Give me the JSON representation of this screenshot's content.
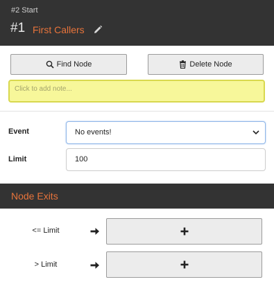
{
  "header": {
    "subtitle": "#2 Start",
    "number": "#1",
    "name": "First Callers",
    "edit_icon": "pencil-icon"
  },
  "toolbar": {
    "find_label": "Find Node",
    "find_icon": "search-icon",
    "delete_label": "Delete Node",
    "delete_icon": "trash-icon"
  },
  "note": {
    "placeholder": "Click to add note..."
  },
  "form": {
    "event_label": "Event",
    "event_value": "No events!",
    "limit_label": "Limit",
    "limit_value": "100"
  },
  "exits": {
    "title": "Node Exits",
    "items": [
      {
        "label": "<= Limit",
        "arrow_icon": "arrow-right-icon",
        "add_icon": "plus-icon"
      },
      {
        "label": "> Limit",
        "arrow_icon": "arrow-right-icon",
        "add_icon": "plus-icon"
      }
    ]
  },
  "colors": {
    "header_bg": "#333333",
    "accent": "#e8743b",
    "note_bg": "#f7f79a",
    "focus_border": "#8fb6e8"
  }
}
